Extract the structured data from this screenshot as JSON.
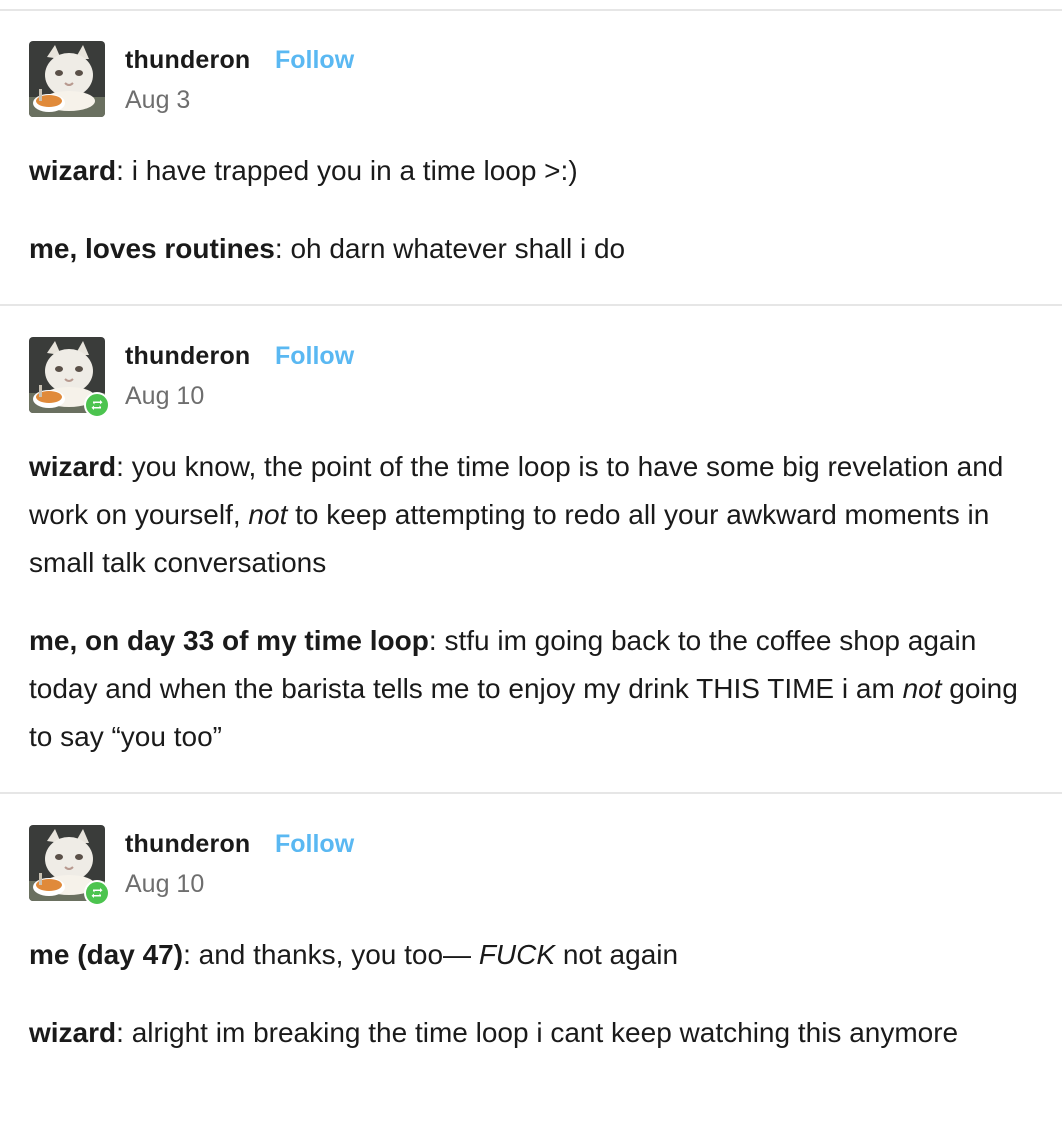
{
  "posts": [
    {
      "username": "thunderon",
      "follow_label": "Follow",
      "date": "Aug 3",
      "reblog_badge": false,
      "paragraphs": [
        {
          "speaker": "wizard",
          "sep": ": ",
          "segments": [
            {
              "text": "i have trapped you in a time loop >:)"
            }
          ]
        },
        {
          "speaker": "me, loves routines",
          "sep": ": ",
          "segments": [
            {
              "text": "oh darn whatever shall i do"
            }
          ]
        }
      ]
    },
    {
      "username": "thunderon",
      "follow_label": "Follow",
      "date": "Aug 10",
      "reblog_badge": true,
      "paragraphs": [
        {
          "speaker": "wizard",
          "sep": ": ",
          "segments": [
            {
              "text": "you know, the point of the time loop is to have some big revelation and work on yourself, "
            },
            {
              "text": "not",
              "italic": true
            },
            {
              "text": " to keep attempting to redo all your awkward moments in small talk conversations"
            }
          ]
        },
        {
          "speaker": "me, on day 33 of my time loop",
          "sep": ": ",
          "segments": [
            {
              "text": "stfu im going back to the coffee shop again today and when the barista tells me to enjoy my drink THIS TIME i am "
            },
            {
              "text": "not",
              "italic": true
            },
            {
              "text": " going to say “you too”"
            }
          ]
        }
      ]
    },
    {
      "username": "thunderon",
      "follow_label": "Follow",
      "date": "Aug 10",
      "reblog_badge": true,
      "paragraphs": [
        {
          "speaker": "me (day 47)",
          "sep": ": ",
          "segments": [
            {
              "text": "and thanks, you too— "
            },
            {
              "text": "FUCK",
              "italic": true
            },
            {
              "text": " not again"
            }
          ]
        },
        {
          "speaker": "wizard",
          "sep": ": ",
          "segments": [
            {
              "text": "alright im breaking the time loop i cant keep watching this anymore"
            }
          ]
        }
      ]
    }
  ],
  "colors": {
    "follow": "#5ab8f2",
    "reblog_badge": "#4cc44f",
    "divider": "#e6e6e6",
    "date": "#6e6e6e",
    "text": "#1a1a1a"
  },
  "icons": {
    "avatar": "cat-with-soup-avatar",
    "reblog": "reblog-icon"
  }
}
